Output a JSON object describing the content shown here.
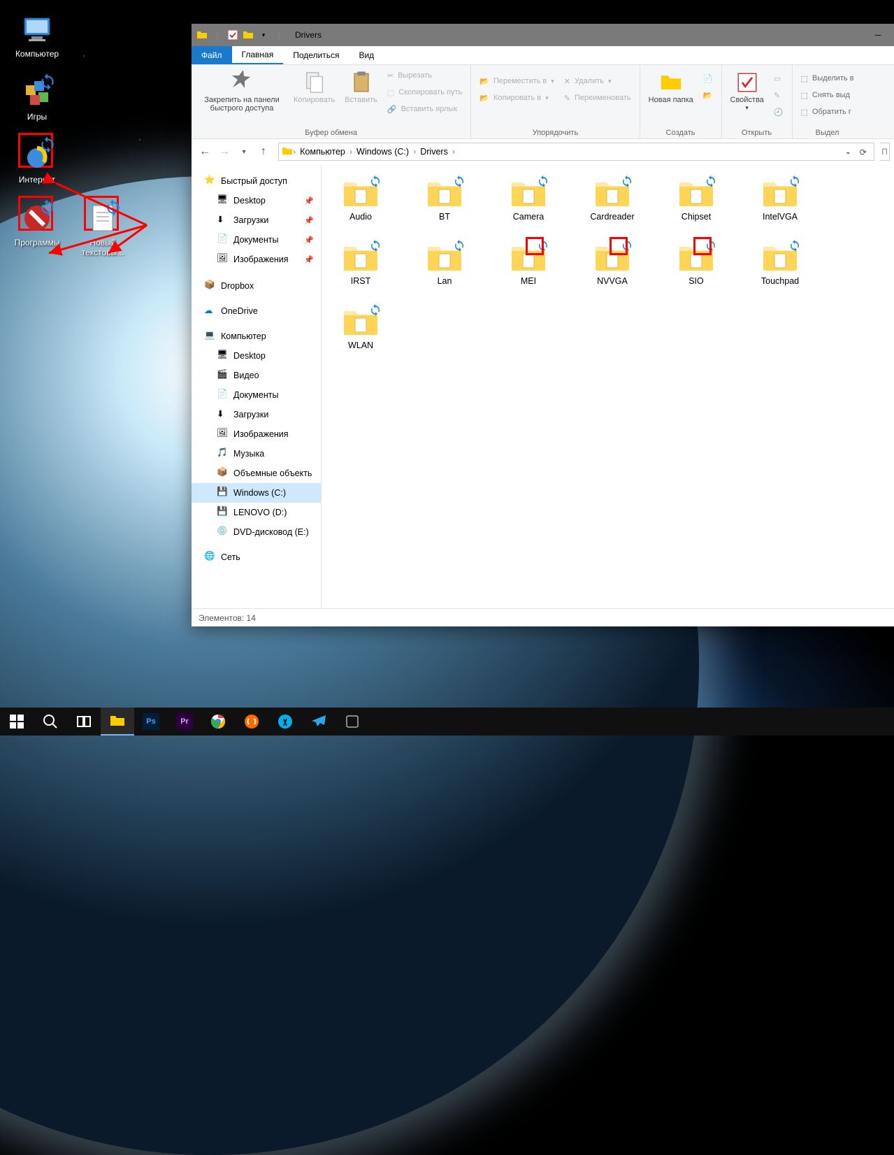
{
  "desktop": {
    "icons": [
      {
        "label": "Компьютер"
      },
      {
        "label": "Игры"
      },
      {
        "label": "Интернет"
      },
      {
        "label": "Программы"
      },
      {
        "label": "Новый текстовы..."
      }
    ]
  },
  "window": {
    "title": "Drivers",
    "tabs": {
      "file": "Файл",
      "home": "Главная",
      "share": "Поделиться",
      "view": "Вид"
    },
    "ribbon": {
      "pin": "Закрепить на панели быстрого доступа",
      "copy": "Копировать",
      "paste": "Вставить",
      "cut": "Вырезать",
      "copy_path": "Скопировать путь",
      "paste_shortcut": "Вставить ярлык",
      "clipboard_label": "Буфер обмена",
      "move_to": "Переместить в",
      "copy_to": "Копировать в",
      "delete": "Удалить",
      "rename": "Переименовать",
      "organize_label": "Упорядочить",
      "new_folder": "Новая папка",
      "create_label": "Создать",
      "properties": "Свойства",
      "open_label": "Открыть",
      "select_all": "Выделить в",
      "select_none": "Снять выд",
      "invert": "Обратить г",
      "select_label": "Выдел"
    },
    "breadcrumbs": [
      "Компьютер",
      "Windows (C:)",
      "Drivers"
    ],
    "search_placeholder": "П",
    "tree": {
      "quick_access": "Быстрый доступ",
      "desktop": "Desktop",
      "downloads": "Загрузки",
      "documents": "Документы",
      "pictures": "Изображения",
      "dropbox": "Dropbox",
      "onedrive": "OneDrive",
      "computer": "Компьютер",
      "c_desktop": "Desktop",
      "c_videos": "Видео",
      "c_documents": "Документы",
      "c_downloads": "Загрузки",
      "c_pictures": "Изображения",
      "c_music": "Музыка",
      "c_3d": "Объемные объекть",
      "c_windows": "Windows (C:)",
      "c_lenovo": "LENOVO (D:)",
      "c_dvd": "DVD-дисковод (E:)",
      "network": "Сеть"
    },
    "folders": [
      "Audio",
      "BT",
      "Camera",
      "Cardreader",
      "Chipset",
      "IntelVGA",
      "IRST",
      "Lan",
      "MEI",
      "NVVGA",
      "SIO",
      "Touchpad",
      "WLAN"
    ],
    "status": "Элементов: 14"
  }
}
